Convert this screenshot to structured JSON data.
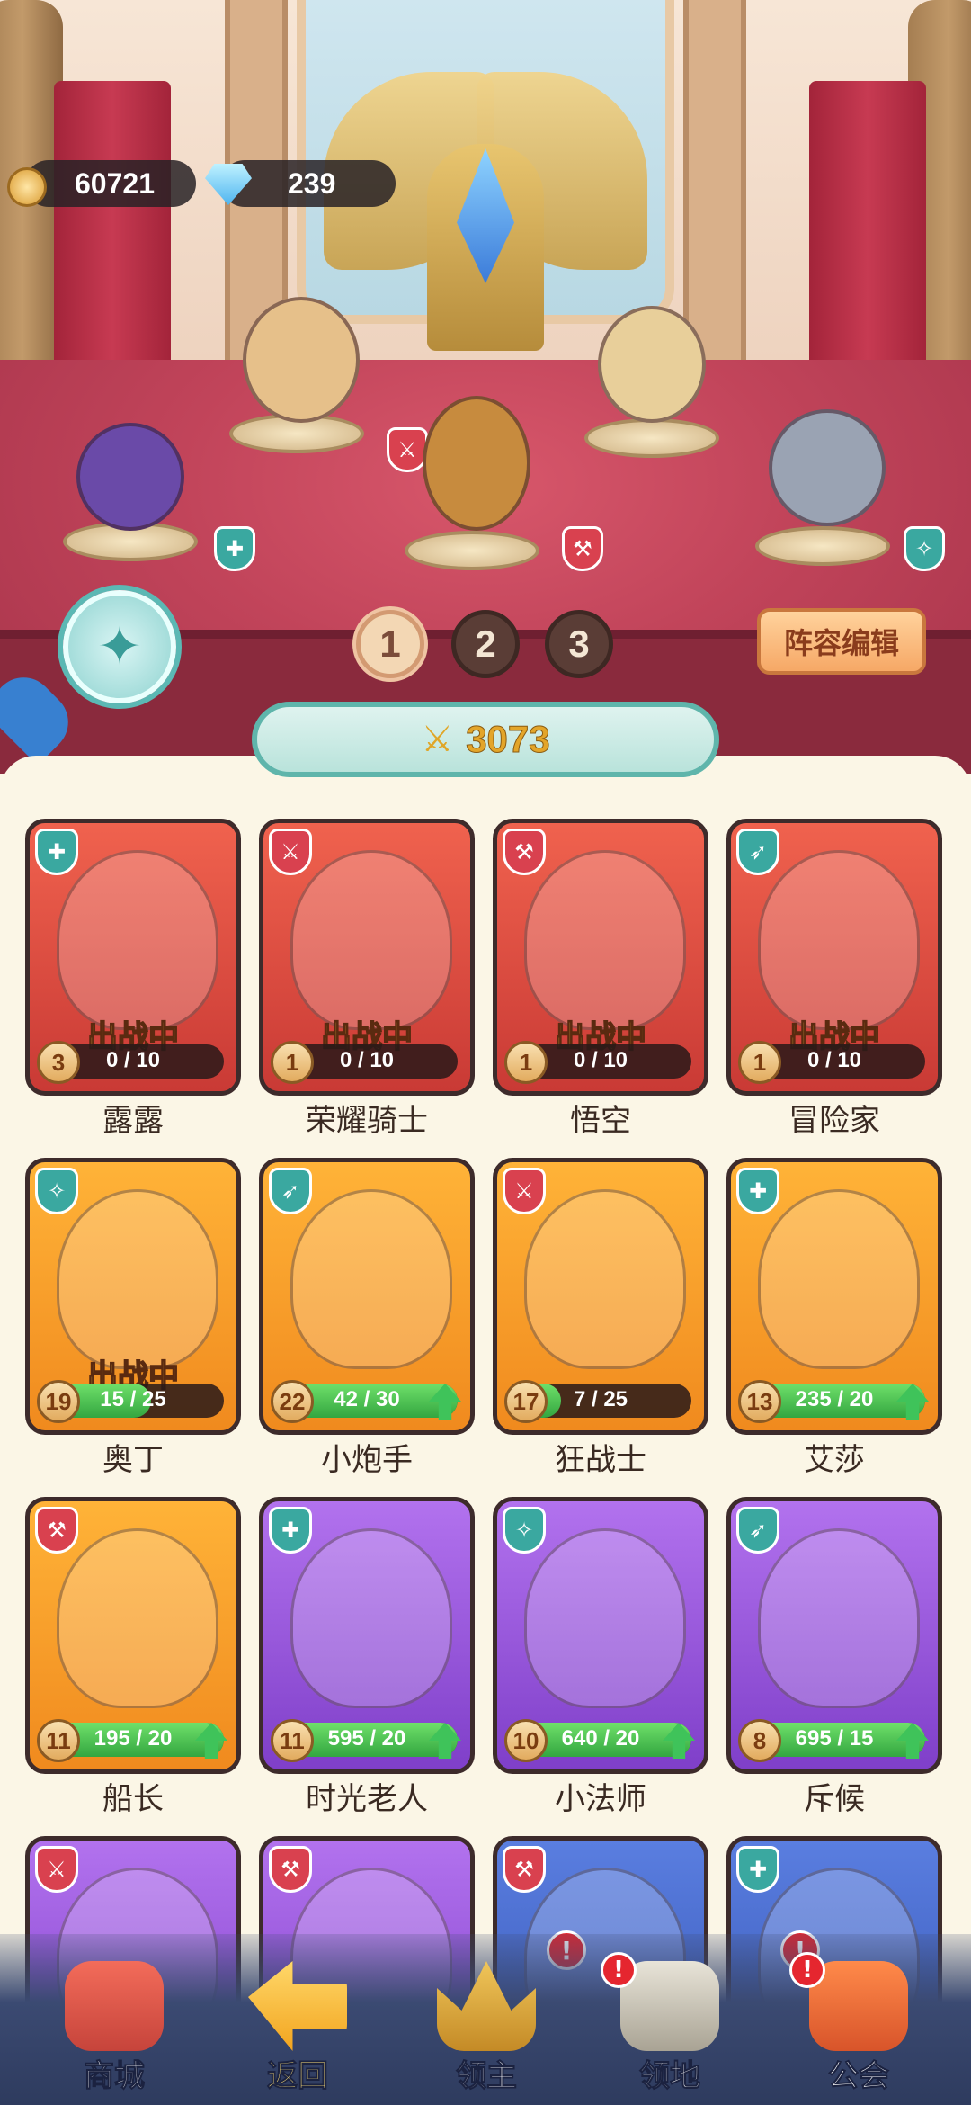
{
  "currency": {
    "gold": "60721",
    "gems": "239"
  },
  "teams": [
    "1",
    "2",
    "3"
  ],
  "active_team": "1",
  "edit_lineup_label": "阵容编辑",
  "power_value": "3073",
  "heroes": [
    {
      "name": "露露",
      "level": "3",
      "progress": "0 / 10",
      "progress_fraction": 0,
      "status": "出战中",
      "frame": "red",
      "class_icon": "support-icon",
      "upgrade": false
    },
    {
      "name": "荣耀骑士",
      "level": "1",
      "progress": "0 / 10",
      "progress_fraction": 0,
      "status": "出战中",
      "frame": "red",
      "class_icon": "shield-icon",
      "upgrade": false
    },
    {
      "name": "悟空",
      "level": "1",
      "progress": "0 / 10",
      "progress_fraction": 0,
      "status": "出战中",
      "frame": "red",
      "class_icon": "axe-icon",
      "upgrade": false
    },
    {
      "name": "冒险家",
      "level": "1",
      "progress": "0 / 10",
      "progress_fraction": 0,
      "status": "出战中",
      "frame": "red",
      "class_icon": "bow-icon",
      "upgrade": false
    },
    {
      "name": "奥丁",
      "level": "19",
      "progress": "15 / 25",
      "progress_fraction": 0.6,
      "status": "出战中",
      "frame": "orange",
      "class_icon": "staff-icon",
      "upgrade": false
    },
    {
      "name": "小炮手",
      "level": "22",
      "progress": "42 / 30",
      "progress_fraction": 1,
      "status": "",
      "frame": "orange",
      "class_icon": "bow-icon",
      "upgrade": true
    },
    {
      "name": "狂战士",
      "level": "17",
      "progress": "7 / 25",
      "progress_fraction": 0.28,
      "status": "",
      "frame": "orange",
      "class_icon": "shield-icon",
      "upgrade": false
    },
    {
      "name": "艾莎",
      "level": "13",
      "progress": "235 / 20",
      "progress_fraction": 1,
      "status": "",
      "frame": "orange",
      "class_icon": "support-icon",
      "upgrade": true
    },
    {
      "name": "船长",
      "level": "11",
      "progress": "195 / 20",
      "progress_fraction": 1,
      "status": "",
      "frame": "orange",
      "class_icon": "axe-icon",
      "upgrade": true
    },
    {
      "name": "时光老人",
      "level": "11",
      "progress": "595 / 20",
      "progress_fraction": 1,
      "status": "",
      "frame": "purple",
      "class_icon": "support-icon",
      "upgrade": true
    },
    {
      "name": "小法师",
      "level": "10",
      "progress": "640 / 20",
      "progress_fraction": 1,
      "status": "",
      "frame": "purple",
      "class_icon": "staff-icon",
      "upgrade": true
    },
    {
      "name": "斥候",
      "level": "8",
      "progress": "695 / 15",
      "progress_fraction": 1,
      "status": "",
      "frame": "purple",
      "class_icon": "bow-icon",
      "upgrade": true
    },
    {
      "name": "",
      "level": "",
      "progress": "",
      "progress_fraction": 0,
      "status": "",
      "frame": "purple",
      "class_icon": "shield-icon",
      "upgrade": false
    },
    {
      "name": "",
      "level": "",
      "progress": "",
      "progress_fraction": 0,
      "status": "",
      "frame": "purple",
      "class_icon": "axe-icon",
      "upgrade": false
    },
    {
      "name": "",
      "level": "",
      "progress": "",
      "progress_fraction": 0,
      "status": "",
      "frame": "blue",
      "class_icon": "axe-icon",
      "upgrade": false
    },
    {
      "name": "",
      "level": "",
      "progress": "",
      "progress_fraction": 0,
      "status": "",
      "frame": "blue",
      "class_icon": "support-icon",
      "upgrade": false
    }
  ],
  "nav": [
    {
      "label": "商城",
      "icon": "shop-icon",
      "active": false,
      "alert": false
    },
    {
      "label": "返回",
      "icon": "back-arrow-icon",
      "active": true,
      "alert": false
    },
    {
      "label": "领主",
      "icon": "crown-icon",
      "active": false,
      "alert": false
    },
    {
      "label": "领地",
      "icon": "castle-icon",
      "active": false,
      "alert": true
    },
    {
      "label": "公会",
      "icon": "guild-banner-icon",
      "active": false,
      "alert": true
    }
  ],
  "colors": {
    "frame_red": "#e0524a",
    "frame_orange": "#f59a28",
    "frame_purple": "#9a58dd",
    "frame_blue": "#4a6acb",
    "accent_teal": "#5fb5ab",
    "power_gold": "#e3a52a"
  }
}
